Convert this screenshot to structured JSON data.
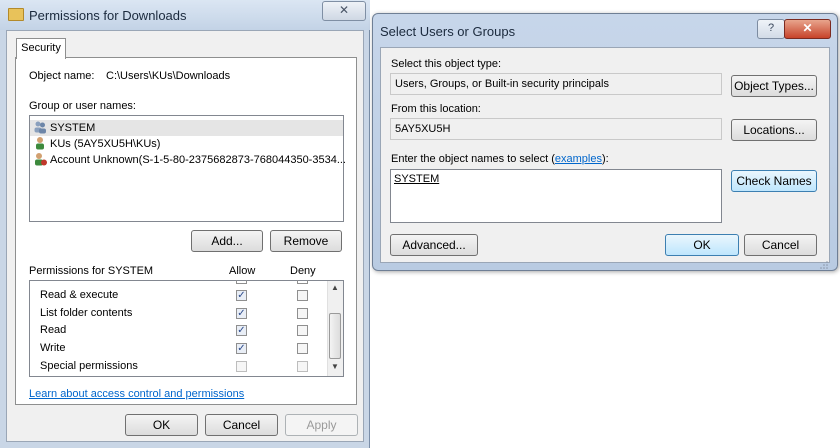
{
  "permissions_window": {
    "title": "Permissions for Downloads",
    "close_glyph": "✕",
    "tab_label": "Security",
    "object_name_label": "Object name:",
    "object_name_value": "C:\\Users\\KUs\\Downloads",
    "group_label": "Group or user names:",
    "users": [
      {
        "name": "SYSTEM",
        "icon": "users-group-icon",
        "selected": true
      },
      {
        "name": "KUs (5AY5XU5H\\KUs)",
        "icon": "user-icon",
        "selected": false
      },
      {
        "name": "Account Unknown(S-1-5-80-2375682873-768044350-3534...",
        "icon": "unknown-user-icon",
        "selected": false
      }
    ],
    "add_button": "Add...",
    "remove_button": "Remove",
    "permissions_for_label": "Permissions for SYSTEM",
    "allow_header": "Allow",
    "deny_header": "Deny",
    "permissions": [
      {
        "name": "Read & execute",
        "allow": true,
        "deny": false
      },
      {
        "name": "List folder contents",
        "allow": true,
        "deny": false
      },
      {
        "name": "Read",
        "allow": true,
        "deny": false
      },
      {
        "name": "Write",
        "allow": true,
        "deny": false
      },
      {
        "name": "Special permissions",
        "allow": false,
        "deny": false
      }
    ],
    "learn_link": "Learn about access control and permissions",
    "ok_button": "OK",
    "cancel_button": "Cancel",
    "apply_button": "Apply"
  },
  "select_dialog": {
    "title": "Select Users or Groups",
    "help_glyph": "?",
    "close_glyph": "✕",
    "object_type_label": "Select this object type:",
    "object_type_value": "Users, Groups, or Built-in security principals",
    "object_types_button": "Object Types...",
    "location_label": "From this location:",
    "location_value": "5AY5XU5H",
    "locations_button": "Locations...",
    "enter_names_label": "Enter the object names to select (",
    "examples_link": "examples",
    "enter_names_suffix": "):",
    "names_value": "SYSTEM",
    "check_names_button": "Check Names",
    "advanced_button": "Advanced...",
    "ok_button": "OK",
    "cancel_button": "Cancel"
  },
  "colors": {
    "titlebar": "#c3d3e6",
    "link": "#0066cc",
    "close_red": "#c7432a"
  }
}
